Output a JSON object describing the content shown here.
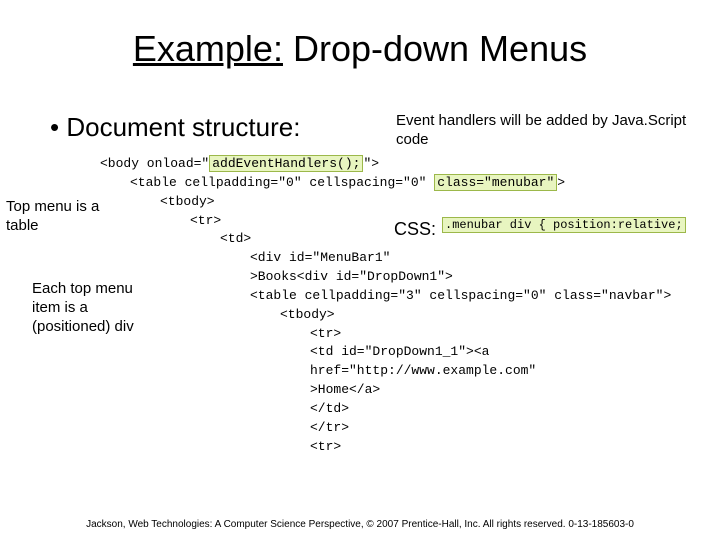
{
  "title_u": "Example:",
  "title_rest": " Drop-down Menus",
  "heading": "Document structure:",
  "note_right": "Event handlers will be added by Java.Script code",
  "note_left": "Top menu is a table",
  "css_label": "CSS:",
  "css_snippet": ".menubar div { position:relative;",
  "note_each": "Each top menu item is a (positioned) div",
  "footer": "Jackson, Web Technologies: A Computer Science Perspective, © 2007 Prentice-Hall, Inc. All rights reserved. 0-13-185603-0",
  "code": {
    "l1a": "<body onload=\"",
    "l1h": "addEventHandlers();",
    "l1b": "\">",
    "l2a": "<table cellpadding=\"0\" cellspacing=\"0\" ",
    "l2h": "class=\"menubar\"",
    "l2b": ">",
    "l3": "<tbody>",
    "l4": "<tr>",
    "l5": "<td>",
    "l6": "<div id=\"MenuBar1\"",
    "l7": ">Books<div id=\"DropDown1\">",
    "l8": "<table cellpadding=\"3\" cellspacing=\"0\" class=\"navbar\">",
    "l9": "<tbody>",
    "l10": "<tr>",
    "l11": "<td id=\"DropDown1_1\"><a",
    "l12": "href=\"http://www.example.com\"",
    "l13": ">Home</a>",
    "l14": "</td>",
    "l15": "</tr>",
    "l16": "<tr>"
  }
}
